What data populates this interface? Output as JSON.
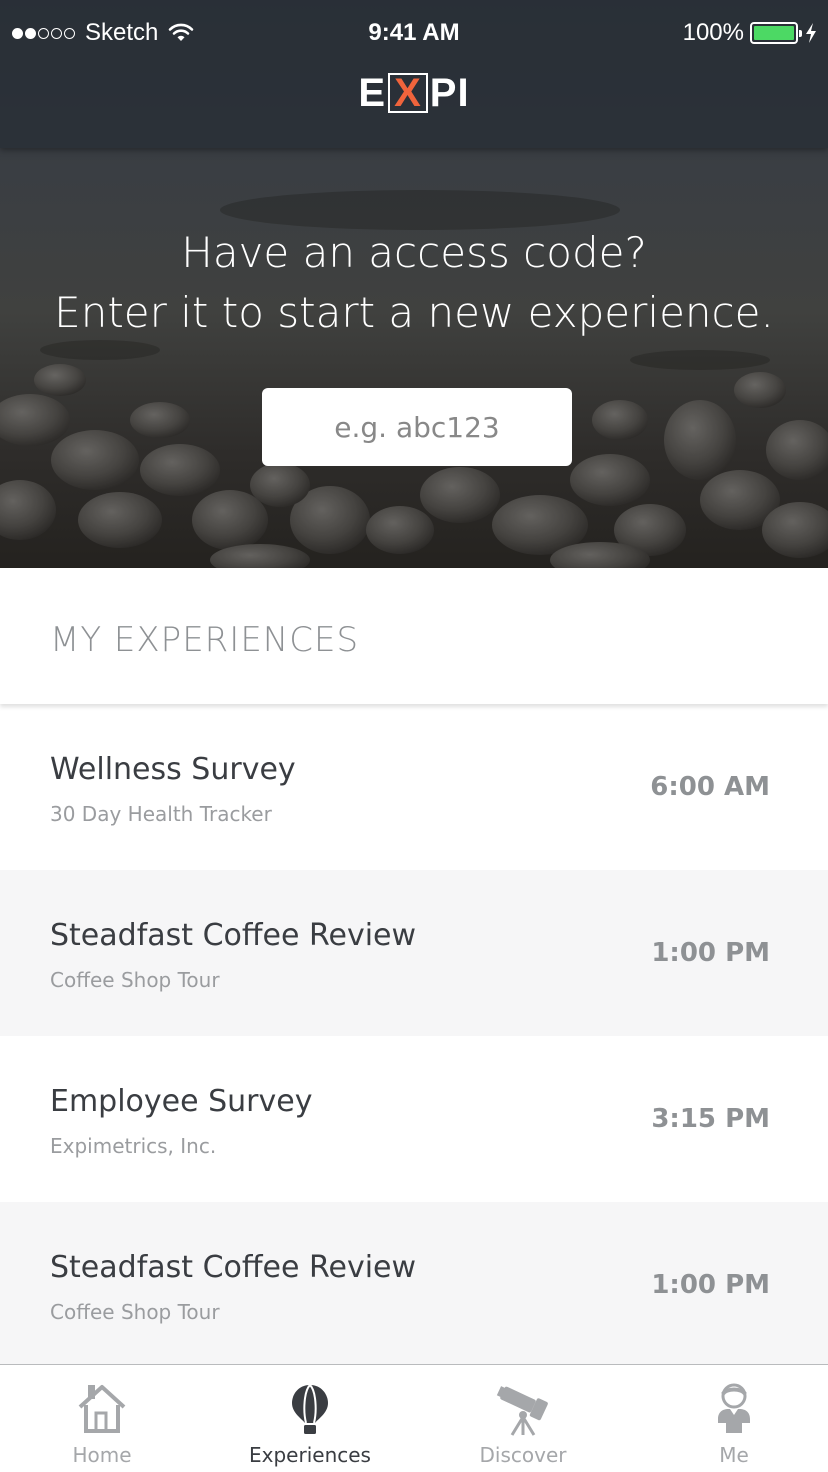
{
  "status_bar": {
    "carrier": "Sketch",
    "time": "9:41 AM",
    "battery": "100%",
    "battery_level": 1.0,
    "signal_bars_filled": 2,
    "signal_bars_total": 5
  },
  "header": {
    "logo_left": "E",
    "logo_mid": "X",
    "logo_right": "PI"
  },
  "hero": {
    "line1": "Have an access code?",
    "line2": "Enter it to start a new experience.",
    "access_code_placeholder": "e.g. abc123"
  },
  "section": {
    "title": "MY EXPERIENCES"
  },
  "experiences": [
    {
      "title": "Wellness Survey",
      "subtitle": "30 Day Health Tracker",
      "time": "6:00 AM"
    },
    {
      "title": "Steadfast Coffee Review",
      "subtitle": "Coffee Shop Tour",
      "time": "1:00 PM"
    },
    {
      "title": "Employee Survey",
      "subtitle": "Expimetrics, Inc.",
      "time": "3:15 PM"
    },
    {
      "title": "Steadfast Coffee Review",
      "subtitle": "Coffee Shop Tour",
      "time": "1:00 PM"
    }
  ],
  "tabs": [
    {
      "label": "Home",
      "icon": "house-icon",
      "active": false
    },
    {
      "label": "Experiences",
      "icon": "hot-air-balloon-icon",
      "active": true
    },
    {
      "label": "Discover",
      "icon": "telescope-icon",
      "active": false
    },
    {
      "label": "Me",
      "icon": "person-icon",
      "active": false
    }
  ],
  "colors": {
    "accent": "#f0643c",
    "battery": "#4cd964",
    "text_dark": "#3a3d42",
    "text_muted": "#8e9194",
    "row_alt": "#f6f6f7"
  }
}
